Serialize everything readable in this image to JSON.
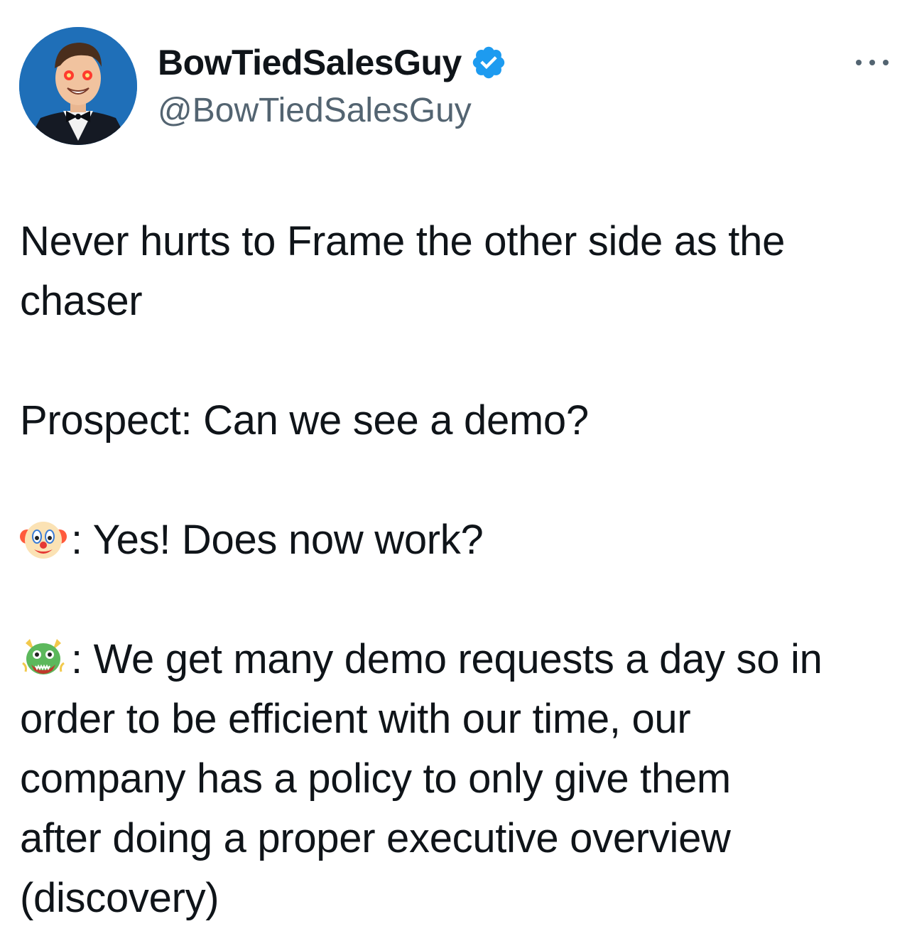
{
  "author": {
    "display_name": "BowTiedSalesGuy",
    "handle": "@BowTiedSalesGuy",
    "verified": true,
    "verified_color": "#1d9bf0"
  },
  "more_menu_icon": "more-horizontal-icon",
  "tweet": {
    "line1": "Never hurts to Frame the other side as the",
    "line2": "chaser",
    "prospect": "Prospect: Can we see a demo?",
    "clown_emoji": "clown-face",
    "clown_reply": ": Yes! Does now work?",
    "dragon_emoji": "dragon-face",
    "dragon_reply_l1": ": We get many demo requests a day so in",
    "dragon_reply_l2": "order to be efficient with our time, our",
    "dragon_reply_l3": "company has a policy to only give them",
    "dragon_reply_l4": "after doing a proper executive overview",
    "dragon_reply_l5": "(discovery)"
  }
}
